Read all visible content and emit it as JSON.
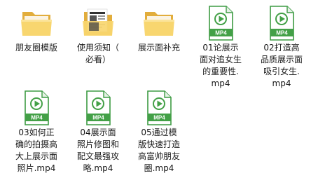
{
  "explorer": {
    "files": [
      {
        "name": "朋友圈模版",
        "type": "folder",
        "icon": "folder-icon"
      },
      {
        "name": "使用须知（\n必看）",
        "type": "folder",
        "icon": "folder-with-documents-icon"
      },
      {
        "name": "展示面补充",
        "type": "folder",
        "icon": "folder-icon"
      },
      {
        "name": "01论展示\n面对追女生\n的重要性.\nmp4",
        "type": "mp4",
        "icon": "mp4-file-icon",
        "badge": "MP4"
      },
      {
        "name": "02打造高\n品质展示面\n吸引女生.\nmp4",
        "type": "mp4",
        "icon": "mp4-file-icon",
        "badge": "MP4"
      },
      {
        "name": "03如何正\n确的拍摄高\n大上展示面\n照片.mp4",
        "type": "mp4",
        "icon": "mp4-file-icon",
        "badge": "MP4"
      },
      {
        "name": "04展示面\n照片修图和\n配文最强攻\n略.mp4",
        "type": "mp4",
        "icon": "mp4-file-icon",
        "badge": "MP4"
      },
      {
        "name": "05通过模\n版快速打造\n高富帅朋友\n圈.mp4",
        "type": "mp4",
        "icon": "mp4-file-icon",
        "badge": "MP4"
      }
    ]
  },
  "colors": {
    "folder_back": "#e8b84a",
    "folder_front": "#f9d977",
    "mp4_green": "#43a047",
    "mp4_border": "#2e7d32"
  }
}
